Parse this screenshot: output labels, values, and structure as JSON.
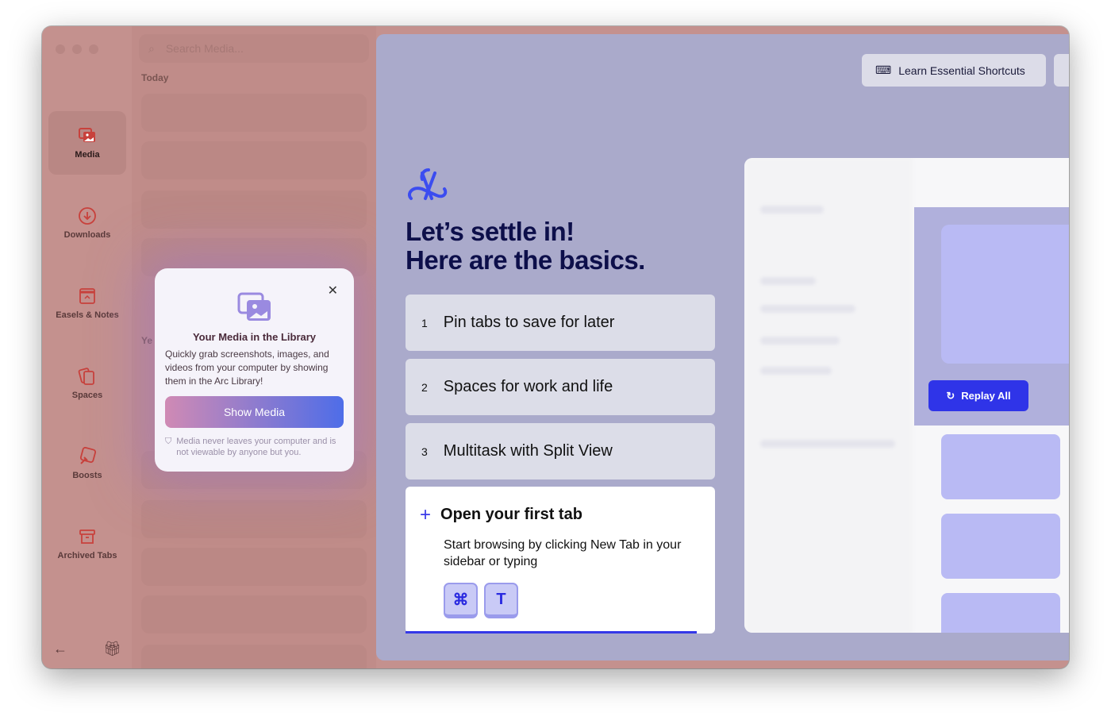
{
  "sidebar": {
    "items": [
      {
        "label": "Media",
        "icon": "media-icon",
        "active": true
      },
      {
        "label": "Downloads",
        "icon": "download-icon"
      },
      {
        "label": "Easels & Notes",
        "icon": "easel-icon"
      },
      {
        "label": "Spaces",
        "icon": "spaces-icon"
      },
      {
        "label": "Boosts",
        "icon": "boosts-icon"
      },
      {
        "label": "Archived Tabs",
        "icon": "archive-icon"
      }
    ],
    "accent": "#c8413c"
  },
  "library": {
    "search_placeholder": "Search Media...",
    "section_today": "Today",
    "section_yesterday": "Ye"
  },
  "popup": {
    "title": "Your Media in the Library",
    "body": "Quickly grab screenshots, images, and videos from your computer by showing them in the Arc Library!",
    "button": "Show Media",
    "note": "Media never leaves your computer and is not viewable by anyone but you."
  },
  "main": {
    "shortcuts_button": "Learn Essential Shortcuts",
    "headline_1": "Let’s settle in!",
    "headline_2": "Here are the basics.",
    "steps": [
      {
        "num": "1",
        "label": "Pin tabs to save for later"
      },
      {
        "num": "2",
        "label": "Spaces for work and life"
      },
      {
        "num": "3",
        "label": "Multitask with Split View"
      }
    ],
    "open_tab": {
      "title": "Open your first tab",
      "body": "Start browsing by clicking New Tab in your sidebar or typing",
      "keys": [
        "⌘",
        "T"
      ]
    },
    "replay_button": "Replay All",
    "accent": "#3438e8"
  }
}
